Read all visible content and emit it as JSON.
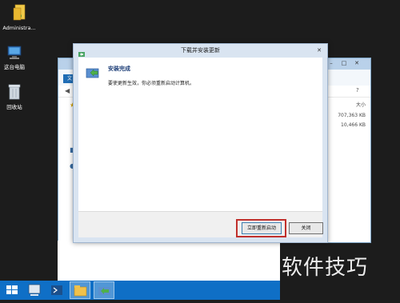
{
  "desktop": {
    "icons": [
      {
        "label": "Administra..."
      },
      {
        "label": "这台电脑"
      },
      {
        "label": "回收站"
      }
    ]
  },
  "explorer": {
    "file_tab": "文",
    "size_header": "大小",
    "sizes": [
      "707,363 KB",
      "10,466 KB"
    ]
  },
  "dialog": {
    "title": "下载并安装更新",
    "heading": "安装完成",
    "message": "要使更新生效，你必须重新启动计算机。",
    "restart_label": "立即重新启动",
    "close_label": "关闭"
  },
  "watermark": "软件技巧",
  "colors": {
    "taskbar": "#0f6fc6",
    "highlight": "#c0302c",
    "dialog_frame": "#d9e4f1"
  }
}
